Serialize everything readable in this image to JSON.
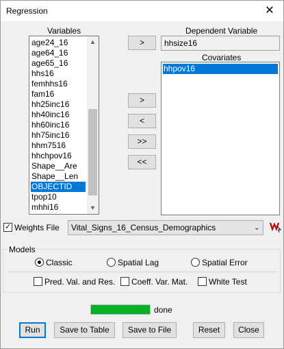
{
  "window": {
    "title": "Regression",
    "close_glyph": "✕"
  },
  "variables": {
    "label": "Variables",
    "items": [
      "age24_16",
      "age64_16",
      "age65_16",
      "hhs16",
      "femhhs16",
      "fam16",
      "hh25inc16",
      "hh40inc16",
      "hh60inc16",
      "hh75inc16",
      "hhm7516",
      "hhchpov16",
      "Shape__Are",
      "Shape__Len",
      "OBJECTID",
      "tpop10",
      "mhhi16"
    ],
    "selected": "OBJECTID"
  },
  "buttons": {
    "add_dependent": ">",
    "add_covariate": ">",
    "remove_covariate": "<",
    "add_all": ">>",
    "remove_all": "<<",
    "run": "Run",
    "save_table": "Save to Table",
    "save_file": "Save to File",
    "reset": "Reset",
    "close": "Close"
  },
  "dependent": {
    "label": "Dependent Variable",
    "value": "hhsize16"
  },
  "covariates": {
    "label": "Covariates",
    "items": [
      "hhpov16"
    ],
    "selected": "hhpov16"
  },
  "weights": {
    "label": "Weights File",
    "checked": true,
    "value": "Vital_Signs_16_Census_Demographics",
    "icon": "weights-icon"
  },
  "models": {
    "label": "Models",
    "options": [
      {
        "label": "Classic",
        "selected": true
      },
      {
        "label": "Spatial Lag",
        "selected": false
      },
      {
        "label": "Spatial Error",
        "selected": false
      }
    ],
    "checks": [
      {
        "label": "Pred. Val. and Res.",
        "checked": false
      },
      {
        "label": "Coeff. Var. Mat.",
        "checked": false
      },
      {
        "label": "White Test",
        "checked": false
      }
    ]
  },
  "progress": {
    "fraction": 1.0,
    "status": "done",
    "color": "#06b025"
  },
  "colors": {
    "selection": "#0078d7",
    "weights_icon": "#c00000"
  }
}
